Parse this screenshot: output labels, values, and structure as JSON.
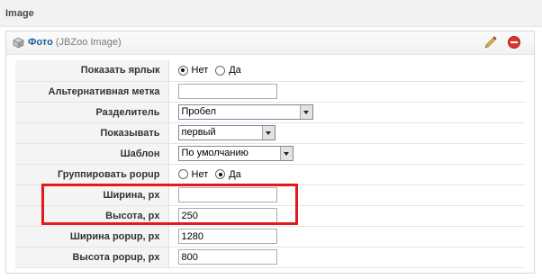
{
  "section": {
    "title": "Image"
  },
  "element": {
    "name": "Фото",
    "type": "(JBZoo Image)",
    "icons": {
      "type_icon": "cube-icon",
      "edit_icon": "pencil-icon",
      "delete_icon": "delete-icon"
    }
  },
  "params": {
    "show_label": {
      "label": "Показать ярлык",
      "options": [
        "Нет",
        "Да"
      ],
      "selected": "Нет"
    },
    "alt_label": {
      "label": "Альтернативная метка",
      "value": ""
    },
    "separator": {
      "label": "Разделитель",
      "selected": "Пробел"
    },
    "show": {
      "label": "Показывать",
      "selected": "первый"
    },
    "template": {
      "label": "Шаблон",
      "selected": "По умолчанию"
    },
    "group_popup": {
      "label": "Группировать popup",
      "options": [
        "Нет",
        "Да"
      ],
      "selected": "Да"
    },
    "width": {
      "label": "Ширина, px",
      "value": ""
    },
    "height": {
      "label": "Высота, px",
      "value": "250"
    },
    "popup_width": {
      "label": "Ширина popup, px",
      "value": "1280"
    },
    "popup_height": {
      "label": "Высота popup, px",
      "value": "800"
    }
  },
  "colors": {
    "highlight": "#e11b1b",
    "link": "#1c5b98",
    "delete": "#d9372c",
    "pencil": "#e8b93a"
  }
}
